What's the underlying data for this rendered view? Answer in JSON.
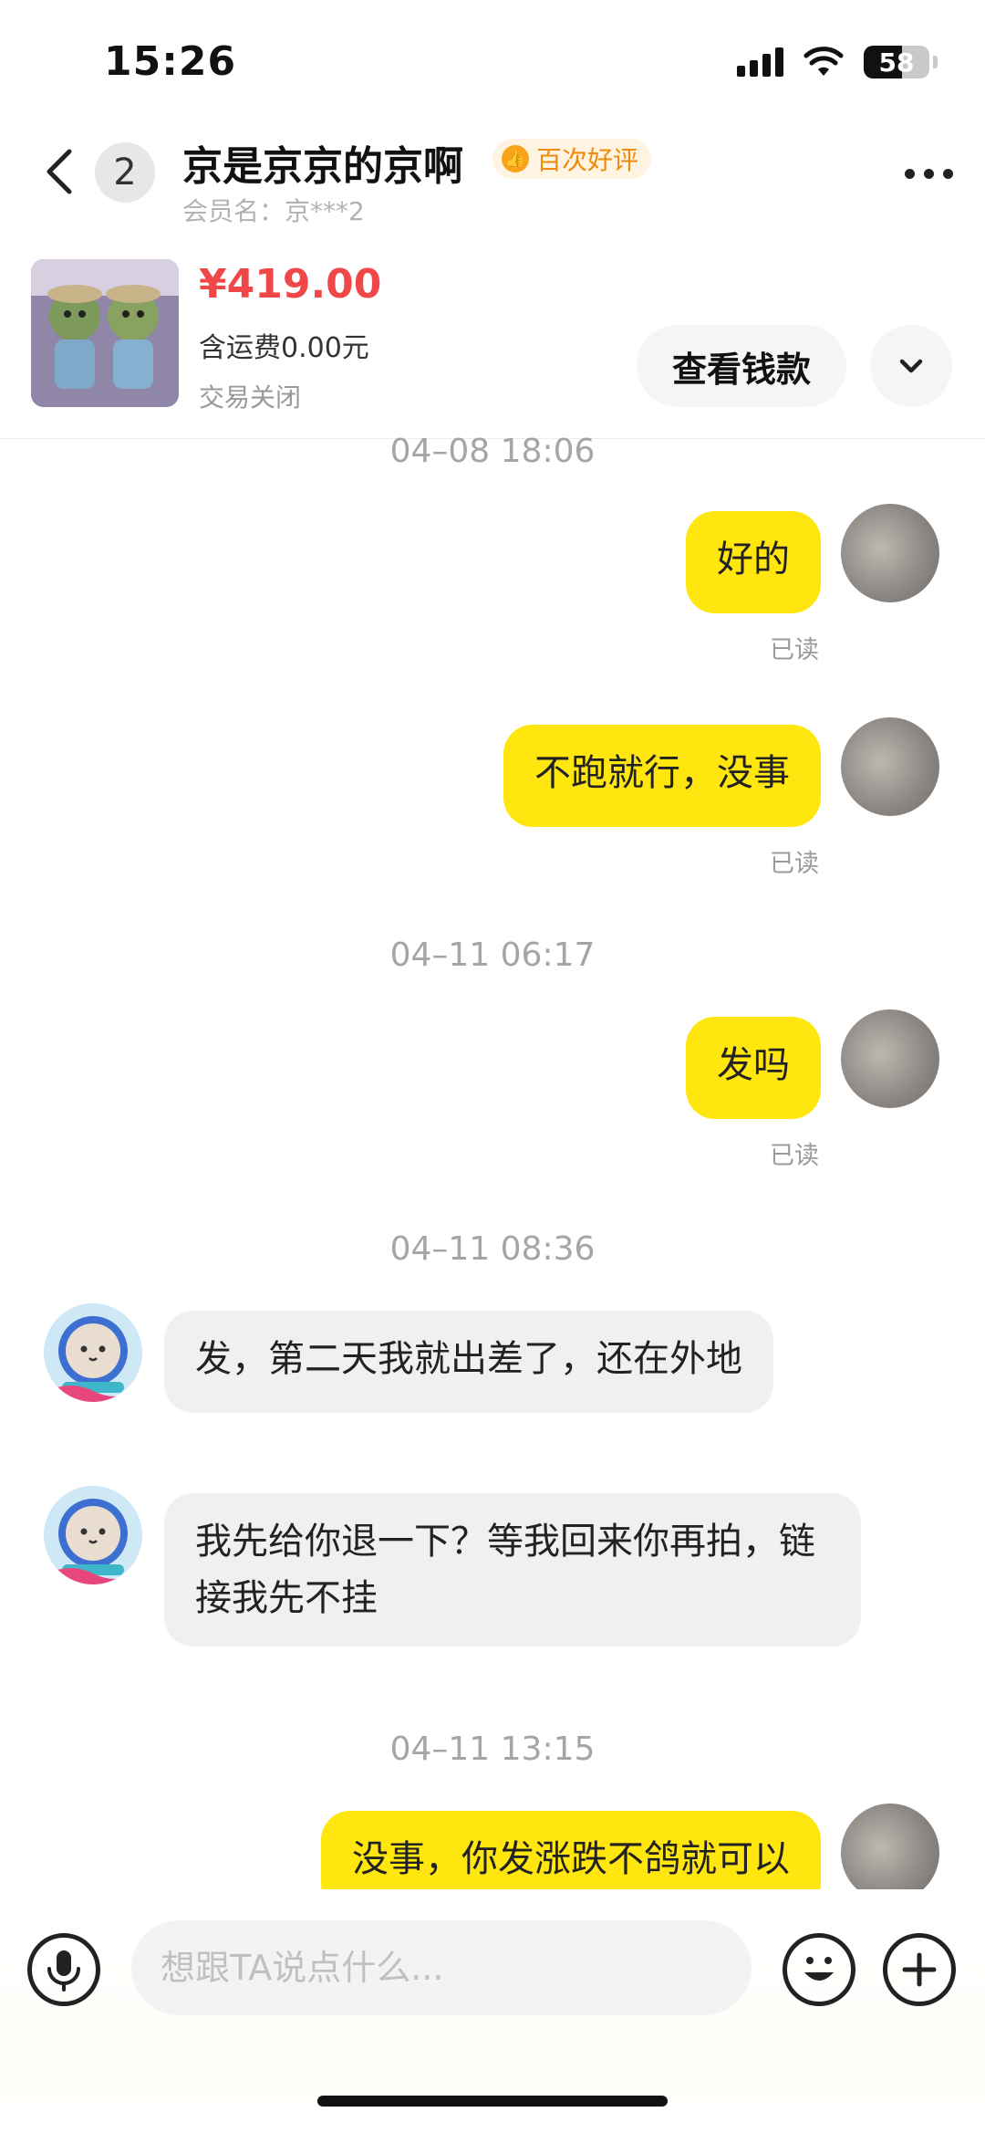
{
  "status_bar": {
    "time": "15:26",
    "battery": "58",
    "battery_level": 0.58
  },
  "header": {
    "unread_count": "2",
    "title": "京是京京的京啊",
    "rating_badge": "百次好评",
    "member_name": "会员名：京***2"
  },
  "product": {
    "price": "¥419.00",
    "shipping": "含运费0.00元",
    "status": "交易关闭",
    "view_payment_label": "查看钱款"
  },
  "messages": {
    "ts1": "04–08 18:06",
    "m1": "好的",
    "m1_read": "已读",
    "m2": "不跑就行，没事",
    "m2_read": "已读",
    "ts2": "04–11 06:17",
    "m3": "发吗",
    "m3_read": "已读",
    "ts3": "04–11 08:36",
    "m4": "发，第二天我就出差了，还在外地",
    "m5": "我先给你退一下？等我回来你再拍，链接我先不挂",
    "ts4": "04–11 13:15",
    "m6": "没事，你发涨跌不鸽就可以"
  },
  "input": {
    "placeholder": "想跟TA说点什么..."
  },
  "colors": {
    "accent_yellow": "#ffe60f",
    "price_red": "#f04848",
    "badge_orange": "#f08a0c"
  }
}
